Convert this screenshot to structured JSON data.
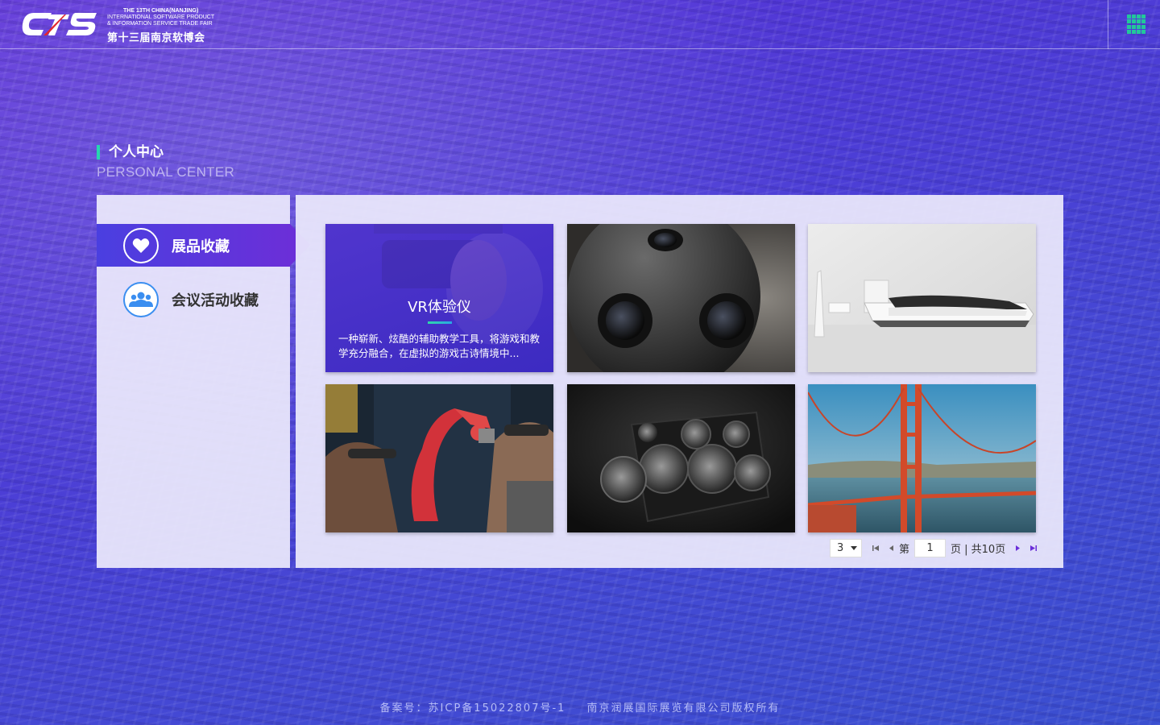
{
  "header": {
    "logo_mark": "CTS",
    "logo_en_line1": "THE 13th CHINA(NANJING)",
    "logo_en_line2": "INTERNATIONAL SOFTWARE PRODUCT",
    "logo_en_line3": "& INFORMATION SERVICE TRADE FAIR",
    "logo_cn": "第十三届南京软博会",
    "menu_icon": "grid-icon",
    "accent_color": "#22c79b"
  },
  "section": {
    "title_cn": "个人中心",
    "title_en": "PERSONAL CENTER"
  },
  "sidebar": {
    "items": [
      {
        "label": "展品收藏",
        "icon": "heart-icon",
        "active": true
      },
      {
        "label": "会议活动收藏",
        "icon": "people-icon",
        "active": false
      }
    ]
  },
  "cards": [
    {
      "title": "VR体验仪",
      "description": "一种崭新、炫酷的辅助教学工具，将游戏和教学充分融合，在虚拟的游戏古诗情境中...",
      "image": "vr-headset-image",
      "highlighted": true
    },
    {
      "image": "spherical-camera-image"
    },
    {
      "image": "floating-bed-image"
    },
    {
      "image": "ar-robot-arm-image"
    },
    {
      "image": "speaker-exploded-image"
    },
    {
      "image": "golden-gate-bridge-image"
    }
  ],
  "pagination": {
    "page_size": "3",
    "prefix": "第",
    "current_page": "1",
    "suffix": "页 | 共10页",
    "first_icon": "first-page-icon",
    "prev_icon": "prev-page-icon",
    "next_icon": "next-page-icon",
    "last_icon": "last-page-icon"
  },
  "footer": {
    "icp": "备案号：苏ICP备15022807号-1",
    "copyright": "南京润展国际展览有限公司版权所有"
  }
}
